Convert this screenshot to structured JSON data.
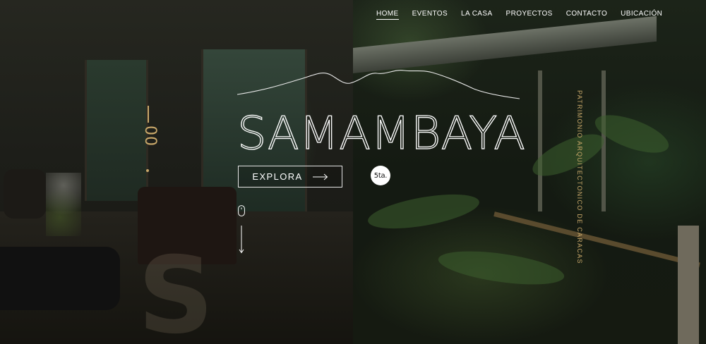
{
  "nav": {
    "items": [
      {
        "label": "HOME",
        "active": true
      },
      {
        "label": "EVENTOS",
        "active": false
      },
      {
        "label": "LA CASA",
        "active": false
      },
      {
        "label": "PROYECTOS",
        "active": false
      },
      {
        "label": "CONTACTO",
        "active": false
      },
      {
        "label": "UBICACIÓN",
        "active": false
      }
    ]
  },
  "hero": {
    "title": "SAMAMBAYA",
    "cta_label": "EXPLORA",
    "badge": "5ta.",
    "slide_counter": "00",
    "side_text": "PATRIMONIO ARQUITECTONICO DE CARACAS",
    "watermark_letter": "S"
  },
  "icons": {
    "mountain": "mountain-outline-icon",
    "arrow": "arrow-right-icon",
    "mouse": "mouse-scroll-icon",
    "down_arrow": "arrow-down-icon"
  },
  "colors": {
    "accent_gold": "#c9a86a",
    "text": "#ffffff"
  }
}
